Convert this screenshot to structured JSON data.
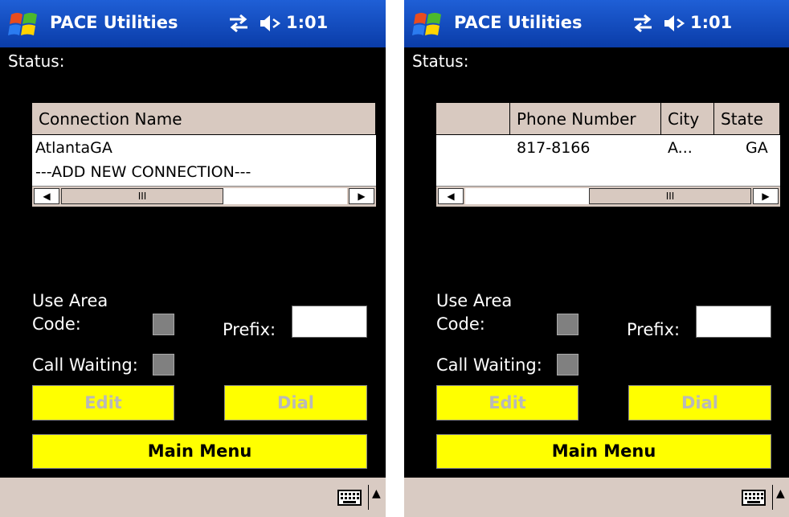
{
  "screens": [
    {
      "title": "PACE Utilities",
      "clock": "1:01",
      "status_label": "Status:",
      "grid": {
        "headers": [
          "Connection Name"
        ],
        "rows": [
          "AtlantaGA",
          "---ADD NEW CONNECTION---"
        ],
        "scroll_thumb": "III"
      },
      "use_area_code_label": "Use Area",
      "code_label": "Code:",
      "prefix_label": "Prefix:",
      "call_waiting_label": "Call Waiting:",
      "prefix_value": "",
      "edit_label": "Edit",
      "dial_label": "Dial",
      "main_menu_label": "Main Menu"
    },
    {
      "title": "PACE Utilities",
      "clock": "1:01",
      "status_label": "Status:",
      "grid": {
        "headers": [
          "",
          "Phone Number",
          "City",
          "State"
        ],
        "row": [
          "",
          "817-8166",
          "A...",
          "GA"
        ],
        "scroll_thumb": "III"
      },
      "use_area_code_label": "Use Area",
      "code_label": "Code:",
      "prefix_label": "Prefix:",
      "call_waiting_label": "Call Waiting:",
      "prefix_value": "",
      "edit_label": "Edit",
      "dial_label": "Dial",
      "main_menu_label": "Main Menu"
    }
  ],
  "colors": {
    "titlebar": "#0a3ca8",
    "button_yellow": "#ffff00",
    "header_beige": "#d8c9c0",
    "background": "#000000"
  },
  "icons": [
    "windows-start-icon",
    "connectivity-icon",
    "speaker-muted-icon",
    "keyboard-icon",
    "input-panel-arrow-icon"
  ]
}
